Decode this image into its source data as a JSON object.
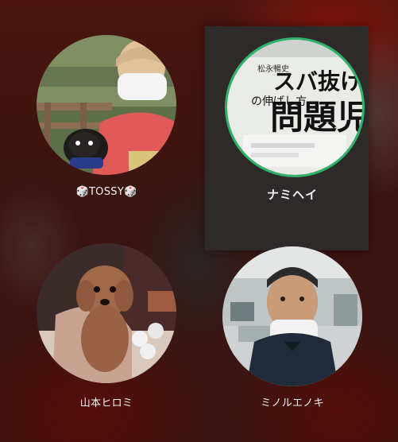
{
  "participants": [
    {
      "name": "🎲TOSSY🎲",
      "avatar_icon": "person-with-dog-photo",
      "active": false
    },
    {
      "name": "ナミヘイ",
      "avatar_icon": "book-cover-photo",
      "active": true,
      "avatar_text": {
        "line1": "スバ抜けた",
        "line2": "問題児",
        "line3": "の伸ばし方",
        "author": "松永暢史"
      }
    },
    {
      "name": "山本ヒロミ",
      "avatar_icon": "toy-poodle-puppy-photo",
      "active": false
    },
    {
      "name": "ミノルエノキ",
      "avatar_icon": "man-with-mask-photo",
      "active": false
    }
  ],
  "colors": {
    "background": "#3a1410",
    "active_tile": "#2d2a29",
    "active_ring": "#2fb36b",
    "name_text": "#f2f2f2"
  }
}
